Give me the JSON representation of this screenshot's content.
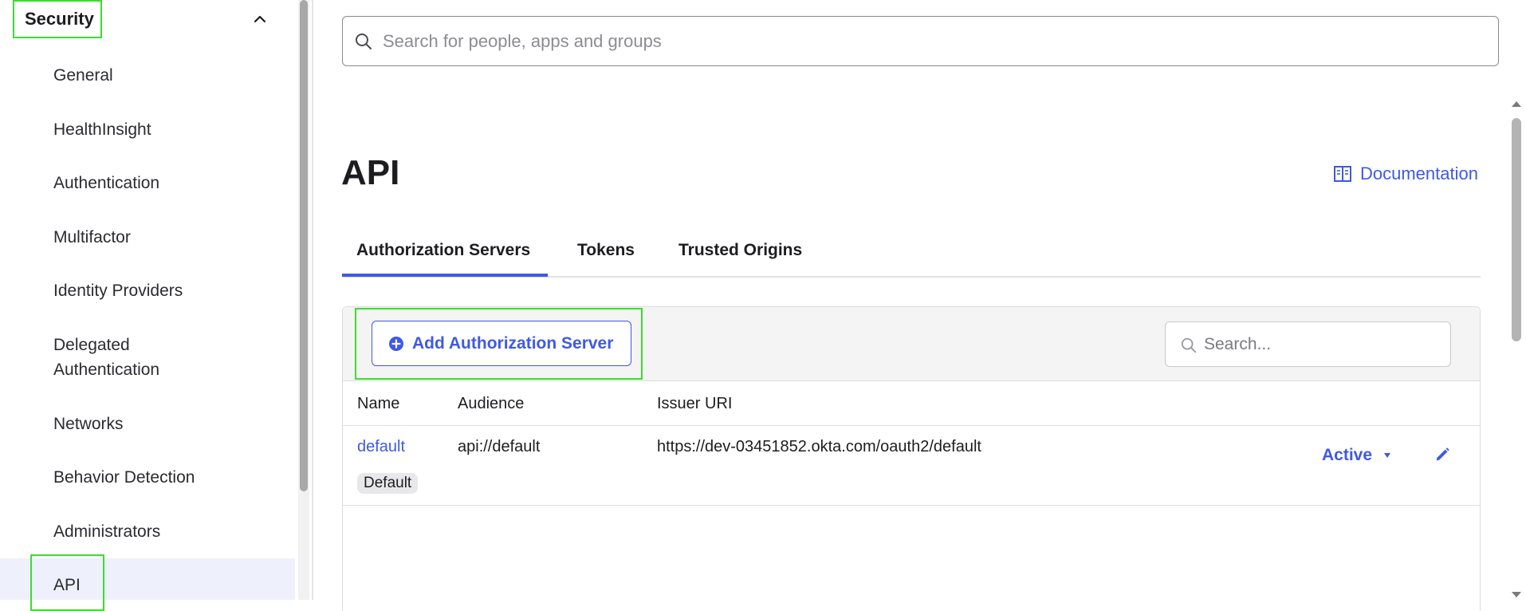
{
  "sidebar": {
    "section_title": "Security",
    "items": [
      {
        "label": "General"
      },
      {
        "label": "HealthInsight"
      },
      {
        "label": "Authentication"
      },
      {
        "label": "Multifactor"
      },
      {
        "label": "Identity Providers"
      },
      {
        "label": "Delegated"
      },
      {
        "label": "Authentication"
      },
      {
        "label": "Networks"
      },
      {
        "label": "Behavior Detection"
      },
      {
        "label": "Administrators"
      },
      {
        "label": "API"
      }
    ]
  },
  "search": {
    "placeholder": "Search for people, apps and groups"
  },
  "page": {
    "title": "API",
    "documentation_label": "Documentation"
  },
  "tabs": [
    {
      "label": "Authorization Servers",
      "active": true
    },
    {
      "label": "Tokens",
      "active": false
    },
    {
      "label": "Trusted Origins",
      "active": false
    }
  ],
  "toolbar": {
    "add_label": "Add Authorization Server",
    "search_placeholder": "Search..."
  },
  "table": {
    "columns": [
      "Name",
      "Audience",
      "Issuer URI"
    ],
    "rows": [
      {
        "name": "default",
        "badge": "Default",
        "audience": "api://default",
        "issuer_uri": "https://dev-03451852.okta.com/oauth2/default",
        "status": "Active"
      }
    ]
  },
  "colors": {
    "accent": "#3f59e4",
    "highlight": "#3ddc2f",
    "active_bg": "#eef0fb"
  }
}
